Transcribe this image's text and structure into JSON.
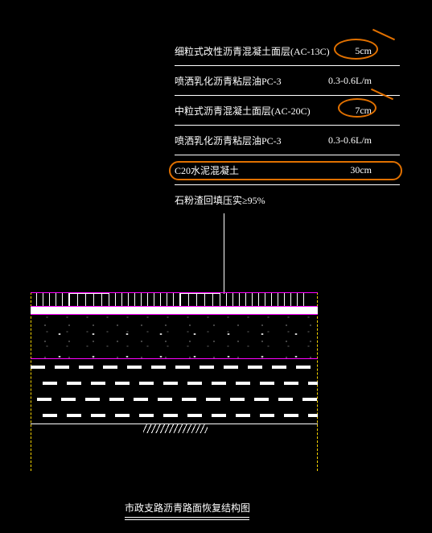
{
  "layers": [
    {
      "text": "细粒式改性沥青混凝土面层(AC-13C)",
      "value": "5cm",
      "highlighted": true
    },
    {
      "text": "喷洒乳化沥青粘层油PC-3",
      "value": "0.3-0.6L/m",
      "highlighted": false
    },
    {
      "text": "中粒式沥青混凝土面层(AC-20C)",
      "value": "7cm",
      "highlighted": true
    },
    {
      "text": "喷洒乳化沥青粘层油PC-3",
      "value": "0.3-0.6L/m",
      "highlighted": false
    },
    {
      "text": "C20水泥混凝土",
      "value": "30cm",
      "highlighted": true
    },
    {
      "text": "石粉渣回填压实≥95%",
      "value": "",
      "highlighted": false
    }
  ],
  "title": "市政支路沥青路面恢复结构图",
  "chart_data": {
    "type": "table",
    "description": "Road pavement layer structure cross-section",
    "rows": [
      {
        "layer": "细粒式改性沥青混凝土面层(AC-13C)",
        "thickness_cm": 5
      },
      {
        "layer": "喷洒乳化沥青粘层油PC-3",
        "rate": "0.3-0.6 L/m"
      },
      {
        "layer": "中粒式沥青混凝土面层(AC-20C)",
        "thickness_cm": 7
      },
      {
        "layer": "喷洒乳化沥青粘层油PC-3",
        "rate": "0.3-0.6 L/m"
      },
      {
        "layer": "C20水泥混凝土",
        "thickness_cm": 30
      },
      {
        "layer": "石粉渣回填压实",
        "compaction_pct_min": 95
      }
    ],
    "annotations": [
      "5cm",
      "7cm",
      "30cm values circled in orange"
    ]
  }
}
